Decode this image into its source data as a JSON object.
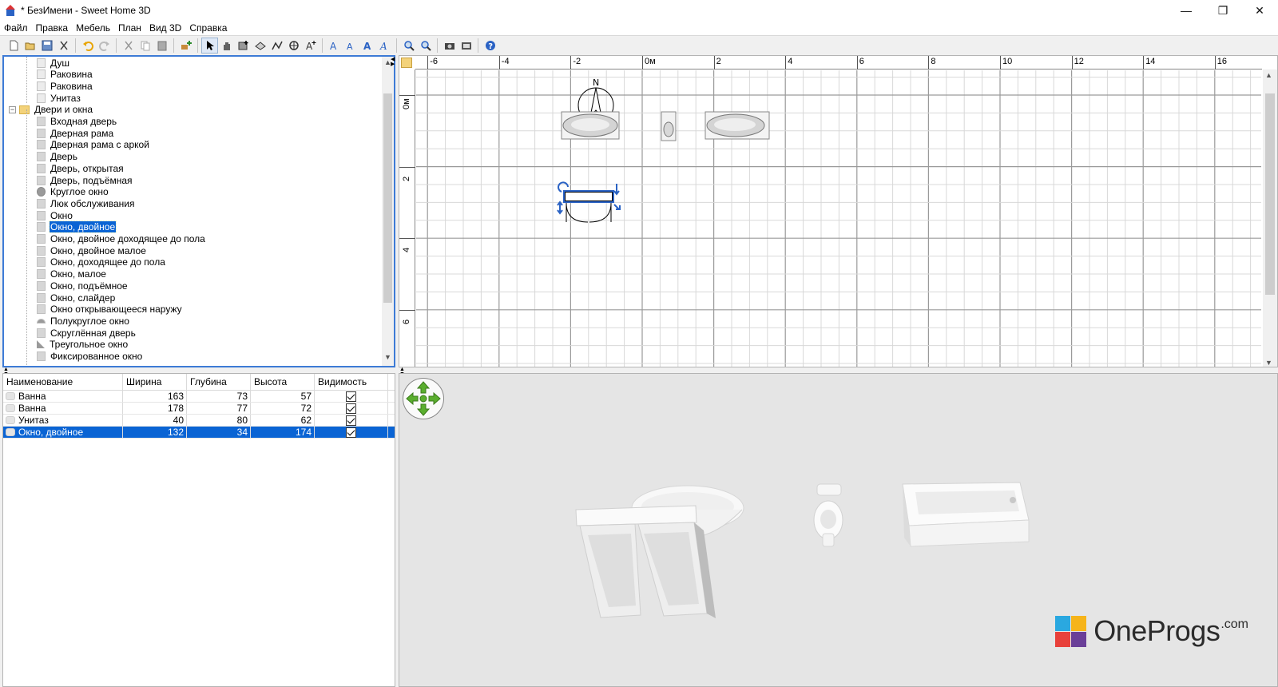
{
  "window": {
    "title": "* БезИмени - Sweet Home 3D",
    "controls": [
      "minimize",
      "restore",
      "close"
    ]
  },
  "menu": [
    "Файл",
    "Правка",
    "Мебель",
    "План",
    "Вид 3D",
    "Справка"
  ],
  "toolbar": {
    "buttons": [
      "new-icon",
      "open-icon",
      "save-icon",
      "cut-icon",
      "undo-icon",
      "redo-icon",
      "cut2-icon",
      "copy-icon",
      "paste-icon",
      "add-furniture-icon",
      "select-icon",
      "pan-icon",
      "create-walls-icon",
      "create-rooms-icon",
      "create-polylines-icon",
      "create-dimensions-icon",
      "add-text-icon",
      "text-style-1-icon",
      "text-style-2-icon",
      "text-style-3-icon",
      "text-style-4-icon",
      "zoom-in-icon",
      "zoom-out-icon",
      "create-photo-icon",
      "create-video-icon",
      "help-icon"
    ]
  },
  "catalog": {
    "items": [
      {
        "label": "Душ",
        "level": 2,
        "icon": "shower-icon"
      },
      {
        "label": "Раковина",
        "level": 2,
        "icon": "sink-icon"
      },
      {
        "label": "Раковина",
        "level": 2,
        "icon": "sink-icon"
      },
      {
        "label": "Унитаз",
        "level": 2,
        "icon": "toilet-icon"
      },
      {
        "label": "Двери и окна",
        "level": 1,
        "icon": "folder-icon",
        "expanded": true
      },
      {
        "label": "Входная дверь",
        "level": 2,
        "icon": "door-icon"
      },
      {
        "label": "Дверная рама",
        "level": 2,
        "icon": "door-frame-icon"
      },
      {
        "label": "Дверная рама с аркой",
        "level": 2,
        "icon": "door-frame-icon"
      },
      {
        "label": "Дверь",
        "level": 2,
        "icon": "door-icon"
      },
      {
        "label": "Дверь, открытая",
        "level": 2,
        "icon": "door-icon"
      },
      {
        "label": "Дверь, подъёмная",
        "level": 2,
        "icon": "garage-door-icon"
      },
      {
        "label": "Круглое окно",
        "level": 2,
        "icon": "round-window-icon"
      },
      {
        "label": "Люк обслуживания",
        "level": 2,
        "icon": "hatch-icon"
      },
      {
        "label": "Окно",
        "level": 2,
        "icon": "window-icon"
      },
      {
        "label": "Окно, двойное",
        "level": 2,
        "icon": "window-icon",
        "selected": true
      },
      {
        "label": "Окно, двойное доходящее до пола",
        "level": 2,
        "icon": "window-icon"
      },
      {
        "label": "Окно, двойное малое",
        "level": 2,
        "icon": "window-icon"
      },
      {
        "label": "Окно, доходящее до пола",
        "level": 2,
        "icon": "window-icon"
      },
      {
        "label": "Окно, малое",
        "level": 2,
        "icon": "window-icon"
      },
      {
        "label": "Окно, подъёмное",
        "level": 2,
        "icon": "window-icon"
      },
      {
        "label": "Окно, слайдер",
        "level": 2,
        "icon": "window-icon"
      },
      {
        "label": "Окно открывающееся наружу",
        "level": 2,
        "icon": "window-icon"
      },
      {
        "label": "Полукруглое окно",
        "level": 2,
        "icon": "half-round-window-icon"
      },
      {
        "label": "Скруглённая дверь",
        "level": 2,
        "icon": "door-icon"
      },
      {
        "label": "Треугольное окно",
        "level": 2,
        "icon": "triangle-window-icon"
      },
      {
        "label": "Фиксированное окно",
        "level": 2,
        "icon": "window-icon"
      }
    ]
  },
  "furniture_table": {
    "columns": [
      "Наименование",
      "Ширина",
      "Глубина",
      "Высота",
      "Видимость"
    ],
    "rows": [
      {
        "name": "Ванна",
        "width": "163",
        "depth": "73",
        "height": "57",
        "visible": true
      },
      {
        "name": "Ванна",
        "width": "178",
        "depth": "77",
        "height": "72",
        "visible": true
      },
      {
        "name": "Унитаз",
        "width": "40",
        "depth": "80",
        "height": "62",
        "visible": true
      },
      {
        "name": "Окно, двойное",
        "width": "132",
        "depth": "34",
        "height": "174",
        "visible": true,
        "selected": true
      }
    ]
  },
  "plan": {
    "ruler_x": [
      "-6",
      "-4",
      "-2",
      "0м",
      "2",
      "4",
      "6",
      "8",
      "10",
      "12",
      "14",
      "16"
    ],
    "ruler_y": [
      "0м",
      "2",
      "4",
      "6"
    ],
    "compass_label": "N"
  },
  "watermark": {
    "brand": "OneProgs",
    "suffix": ".com",
    "colors": [
      "#2aa8e0",
      "#f6b41a",
      "#e8413b",
      "#6a3f98"
    ]
  },
  "colors": {
    "selection": "#0a64d4",
    "focus_border": "#3d7bd6",
    "nav_arrows": "#5aae2e"
  }
}
